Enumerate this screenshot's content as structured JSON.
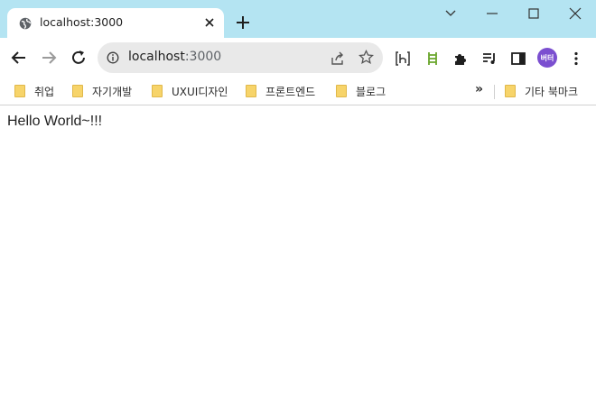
{
  "tab": {
    "title": "localhost:3000",
    "favicon": "globe-icon",
    "close_icon": "close-icon"
  },
  "window_controls": [
    "chevron-down-icon",
    "minimize-icon",
    "maximize-icon",
    "close-icon"
  ],
  "nav": {
    "back_icon": "arrow-left-icon",
    "forward_icon": "arrow-right-icon",
    "reload_icon": "reload-icon"
  },
  "omnibox": {
    "host": "localhost",
    "port": ":3000",
    "info_icon": "info-icon",
    "share_icon": "share-icon",
    "star_icon": "star-icon"
  },
  "extensions": [
    "bracket-h-icon",
    "ladder-icon",
    "puzzle-icon",
    "playlist-icon",
    "sidepanel-icon"
  ],
  "profile": {
    "avatar_text": "버터",
    "avatar_color": "#7b4fd0"
  },
  "bookmarks": {
    "items": [
      {
        "label": "취업"
      },
      {
        "label": "자기개발"
      },
      {
        "label": "UXUI디자인"
      },
      {
        "label": "프론트엔드"
      },
      {
        "label": "블로그"
      }
    ],
    "more_label": "»",
    "other_label": "기타 북마크"
  },
  "page": {
    "text": "Hello World~!!!"
  },
  "colors": {
    "titlebar": "#b4e4f2",
    "folder": "#f7d46a"
  }
}
